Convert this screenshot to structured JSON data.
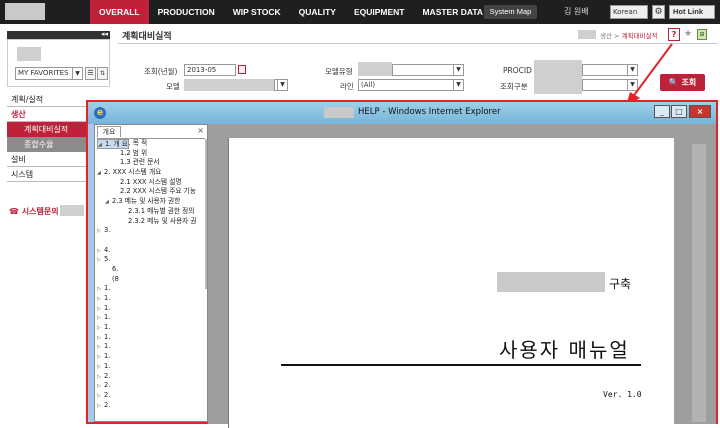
{
  "topbar": {
    "menu": [
      "OVERALL",
      "PRODUCTION",
      "WIP STOCK",
      "QUALITY",
      "EQUIPMENT",
      "MASTER DATA"
    ],
    "active_menu": "OVERALL",
    "system_map": "System Map",
    "user_name": "김 원배",
    "language": "Korean",
    "hot_link": "Hot Link"
  },
  "sidebar": {
    "favorites": "MY FAVORITES",
    "items": [
      {
        "label": "계획/실적"
      },
      {
        "label": "생산"
      },
      {
        "label": "계획대비실적"
      },
      {
        "label": "종합수율"
      },
      {
        "label": "설비"
      },
      {
        "label": "시스템"
      }
    ],
    "system_inquiry": "시스템문의"
  },
  "page": {
    "title": "계획대비실적",
    "breadcrumb_mid": "생산 >",
    "breadcrumb_cur": "계획대비실적",
    "help_icon": "?",
    "star_icon": "★",
    "grid_icon": "⊞"
  },
  "filters": {
    "inquiry_ym_label": "조회(년월)",
    "inquiry_ym_value": "2013-05",
    "model_label": "모델",
    "model_type_label": "모델유형",
    "line_label": "라인",
    "line_value": "(All)",
    "procid_label": "PROCID",
    "inquiry_type_label": "조회구분",
    "search_button": "조회"
  },
  "help_window": {
    "title": "HELP - Windows Internet Explorer",
    "tab_label": "개요",
    "tree": [
      {
        "text": "1. 개 요",
        "indent": 0,
        "toggle": "◢",
        "selected": true
      },
      {
        "text": "1.1  목 적",
        "indent": 2,
        "toggle": ""
      },
      {
        "text": "1.2  범 위",
        "indent": 2,
        "toggle": ""
      },
      {
        "text": "1.3  관련 문서",
        "indent": 2,
        "toggle": ""
      },
      {
        "text": "XXX 시스템 개요",
        "indent": 0,
        "toggle": "◢",
        "prefix": "2. "
      },
      {
        "text": "2.1  XXX 시스템 설명",
        "indent": 2,
        "toggle": ""
      },
      {
        "text": "2.2  XXX 시스템 주요 기능",
        "indent": 2,
        "toggle": ""
      },
      {
        "text": "2.3  메뉴 및 사용자 권한",
        "indent": 1,
        "toggle": "◢"
      },
      {
        "text": "2.3.1  메뉴별 권한 정의",
        "indent": 3,
        "toggle": ""
      },
      {
        "text": "2.3.2  메뉴 및 사용자 권",
        "indent": 3,
        "toggle": ""
      },
      {
        "text": "3.",
        "indent": 0,
        "toggle": "▷"
      },
      {
        "text": "",
        "indent": 0,
        "toggle": ""
      },
      {
        "text": "4.",
        "indent": 0,
        "toggle": "▷"
      },
      {
        "text": "5.",
        "indent": 0,
        "toggle": "▷"
      },
      {
        "text": "6.",
        "indent": 1,
        "toggle": ""
      },
      {
        "text": "(8",
        "indent": 1,
        "toggle": ""
      },
      {
        "text": "1.",
        "indent": 0,
        "toggle": "▷"
      },
      {
        "text": "1.",
        "indent": 0,
        "toggle": "▷"
      },
      {
        "text": "1.",
        "indent": 0,
        "toggle": "▷"
      },
      {
        "text": "1.",
        "indent": 0,
        "toggle": "▷"
      },
      {
        "text": "1.",
        "indent": 0,
        "toggle": "▷"
      },
      {
        "text": "1.",
        "indent": 0,
        "toggle": "▷"
      },
      {
        "text": "1.",
        "indent": 0,
        "toggle": "▷"
      },
      {
        "text": "1.",
        "indent": 0,
        "toggle": "▷"
      },
      {
        "text": "1.",
        "indent": 0,
        "toggle": "▷"
      },
      {
        "text": "2.",
        "indent": 0,
        "toggle": "▷"
      },
      {
        "text": "2.",
        "indent": 0,
        "toggle": "▷"
      },
      {
        "text": "2.",
        "indent": 0,
        "toggle": "▷"
      },
      {
        "text": "2.",
        "indent": 0,
        "toggle": "▷"
      }
    ],
    "doc": {
      "build_suffix": "구축",
      "title": "사용자 매뉴얼",
      "version": "Ver. 1.0"
    }
  },
  "colors": {
    "brand_red": "#c0213a",
    "topbar": "#1f1f1f",
    "highlight_border": "#e0242c"
  }
}
